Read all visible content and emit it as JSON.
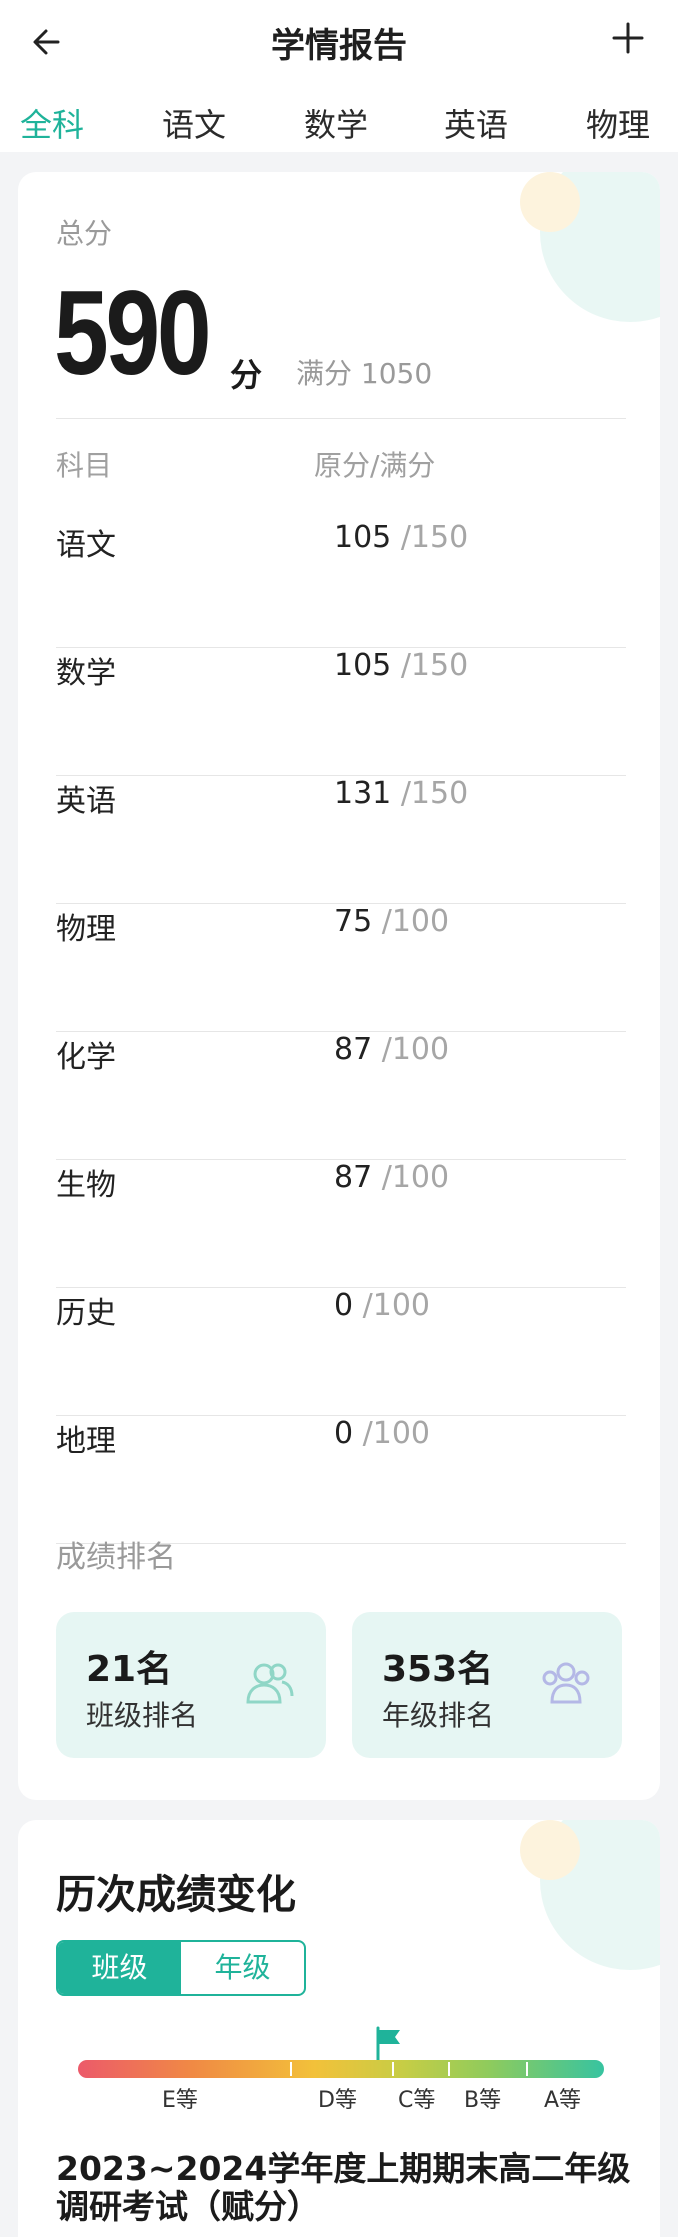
{
  "header": {
    "title": "学情报告",
    "back_icon": "arrow-left-icon",
    "add_icon": "plus-icon"
  },
  "tabs": [
    "全科",
    "语文",
    "数学",
    "英语",
    "物理"
  ],
  "active_tab": "全科",
  "summary": {
    "total_label": "总分",
    "total_score": "590",
    "score_unit": "分",
    "full_label": "满分 1050"
  },
  "table": {
    "col_subject": "科目",
    "col_score": "原分/满分",
    "rows": [
      {
        "subject": "语文",
        "score": "105",
        "max": "/150"
      },
      {
        "subject": "数学",
        "score": "105",
        "max": "/150"
      },
      {
        "subject": "英语",
        "score": "131",
        "max": "/150"
      },
      {
        "subject": "物理",
        "score": "75",
        "max": "/100"
      },
      {
        "subject": "化学",
        "score": "87",
        "max": "/100"
      },
      {
        "subject": "生物",
        "score": "87",
        "max": "/100"
      },
      {
        "subject": "历史",
        "score": "0",
        "max": "/100"
      },
      {
        "subject": "地理",
        "score": "0",
        "max": "/100"
      }
    ]
  },
  "ranking": {
    "label": "成绩排名",
    "class_rank": "21名",
    "class_label": "班级排名",
    "grade_rank": "353名",
    "grade_label": "年级排名"
  },
  "history": {
    "title": "历次成绩变化",
    "toggle": [
      "班级",
      "年级"
    ],
    "toggle_selected": "班级",
    "grades": [
      "E等",
      "D等",
      "C等",
      "B等",
      "A等"
    ],
    "exam_title": "2023~2024学年度上期期末高二年级调研考试（赋分）"
  },
  "colors": {
    "accent": "#1fb39a",
    "rank_bg": "#e6f6f3"
  }
}
